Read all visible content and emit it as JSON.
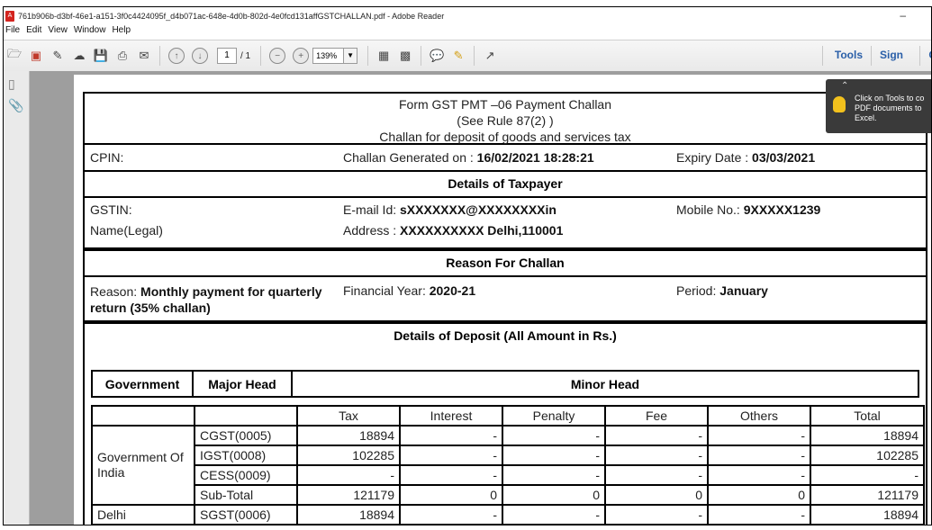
{
  "window": {
    "title": "761b906b-d3bf-46e1-a151-3f0c4424095f_d4b071ac-648e-4d0b-802d-4e0fcd131affGSTCHALLAN.pdf - Adobe Reader",
    "minimize": "–"
  },
  "menu": [
    "File",
    "Edit",
    "View",
    "Window",
    "Help"
  ],
  "toolbar": {
    "page_current": "1",
    "page_total": "/ 1",
    "zoom": "139%",
    "tools_label": "Tools",
    "sign_label": "Sign",
    "more_label": "C"
  },
  "tooltip": {
    "message": "Click on Tools to co PDF documents to Excel."
  },
  "challan": {
    "title_line1": "Form GST PMT –06 Payment Challan",
    "title_line2": "(See Rule  87(2) )",
    "title_line3": "Challan for deposit of goods and services tax",
    "cpin_label": "CPIN:",
    "generated_label": "Challan Generated on : ",
    "generated_value": "16/02/2021 18:28:21",
    "expiry_label": "Expiry Date : ",
    "expiry_value": "03/03/2021",
    "taxpayer_title": "Details of Taxpayer",
    "gstin_label": "GSTIN:",
    "email_label": "E-mail Id: ",
    "email_value": "sXXXXXXX@XXXXXXXXin",
    "mobile_label": "Mobile No.: ",
    "mobile_value": "9XXXXX1239",
    "name_label": "Name(Legal)",
    "address_label": "Address : ",
    "address_value": "XXXXXXXXXX Delhi,110001",
    "reason_title": "Reason For Challan",
    "reason_label": "Reason: ",
    "reason_value": "Monthly payment for quarterly return (35% challan)",
    "fy_label": "Financial Year: ",
    "fy_value": "2020-21",
    "period_label": "Period: ",
    "period_value": "January",
    "deposit_title": "Details of Deposit    (All Amount in Rs.)",
    "heads": [
      "Government",
      "Major Head",
      "Minor Head"
    ],
    "columns": [
      "Tax",
      "Interest",
      "Penalty",
      "Fee",
      "Others",
      "Total"
    ],
    "gov_india_label": "Government Of India",
    "delhi_label": "Delhi",
    "rows": [
      {
        "head": "CGST(0005)",
        "values": [
          "18894",
          "-",
          "-",
          "-",
          "-",
          "18894"
        ]
      },
      {
        "head": "IGST(0008)",
        "values": [
          "102285",
          "-",
          "-",
          "-",
          "-",
          "102285"
        ]
      },
      {
        "head": "CESS(0009)",
        "values": [
          "-",
          "-",
          "-",
          "-",
          "-",
          "-"
        ]
      },
      {
        "head": "Sub-Total",
        "values": [
          "121179",
          "0",
          "0",
          "0",
          "0",
          "121179"
        ]
      },
      {
        "head": "SGST(0006)",
        "values": [
          "18894",
          "-",
          "-",
          "-",
          "-",
          "18894"
        ]
      }
    ]
  }
}
